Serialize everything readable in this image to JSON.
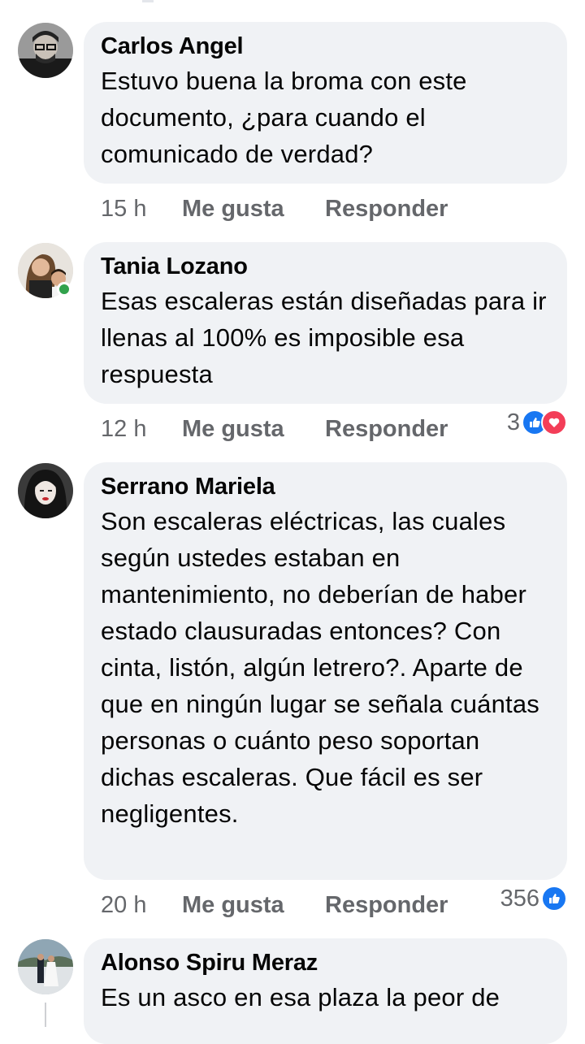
{
  "comments": [
    {
      "author": "Carlos Angel",
      "text": "Estuvo buena la broma con este documento, ¿para cuando el comunicado de verdad?",
      "time": "15 h",
      "like_label": "Me gusta",
      "reply_label": "Responder",
      "reaction_count": "",
      "online": false
    },
    {
      "author": "Tania Lozano",
      "text": "Esas escaleras están diseñadas para ir llenas al 100% es imposible esa respuesta",
      "time": "12 h",
      "like_label": "Me gusta",
      "reply_label": "Responder",
      "reaction_count": "3",
      "reactions": [
        "like-icon",
        "love-icon"
      ],
      "online": true
    },
    {
      "author": "Serrano Mariela",
      "text": "Son escaleras eléctricas, las cuales según ustedes estaban en mantenimiento, no deberían de haber estado clausuradas entonces? Con cinta, listón, algún letrero?. Aparte de que en ningún lugar se señala cuántas personas o cuánto peso soportan dichas escaleras. Que fácil es ser negligentes.",
      "time": "20 h",
      "like_label": "Me gusta",
      "reply_label": "Responder",
      "reaction_count": "356",
      "reactions": [
        "like-icon"
      ],
      "online": false
    },
    {
      "author": "Alonso Spiru Meraz",
      "text": "Es un asco en esa plaza la peor de",
      "online": false
    }
  ],
  "colors": {
    "bubble": "#f0f2f5",
    "meta_text": "#65676b",
    "like_blue": "#1877f2",
    "love_red": "#f33e58",
    "online_green": "#31a24c"
  }
}
